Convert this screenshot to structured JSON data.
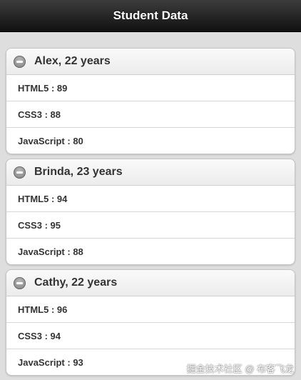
{
  "header": {
    "title": "Student Data"
  },
  "students": [
    {
      "title": "Alex, 22 years",
      "scores": [
        "HTML5 : 89",
        "CSS3 : 88",
        "JavaScript : 80"
      ]
    },
    {
      "title": "Brinda, 23 years",
      "scores": [
        "HTML5 : 94",
        "CSS3 : 95",
        "JavaScript : 88"
      ]
    },
    {
      "title": "Cathy, 22 years",
      "scores": [
        "HTML5 : 96",
        "CSS3 : 94",
        "JavaScript : 93"
      ]
    }
  ],
  "watermark": "掘金技术社区 @ 布客飞龙",
  "icons": {
    "collapse": "minus-icon"
  }
}
